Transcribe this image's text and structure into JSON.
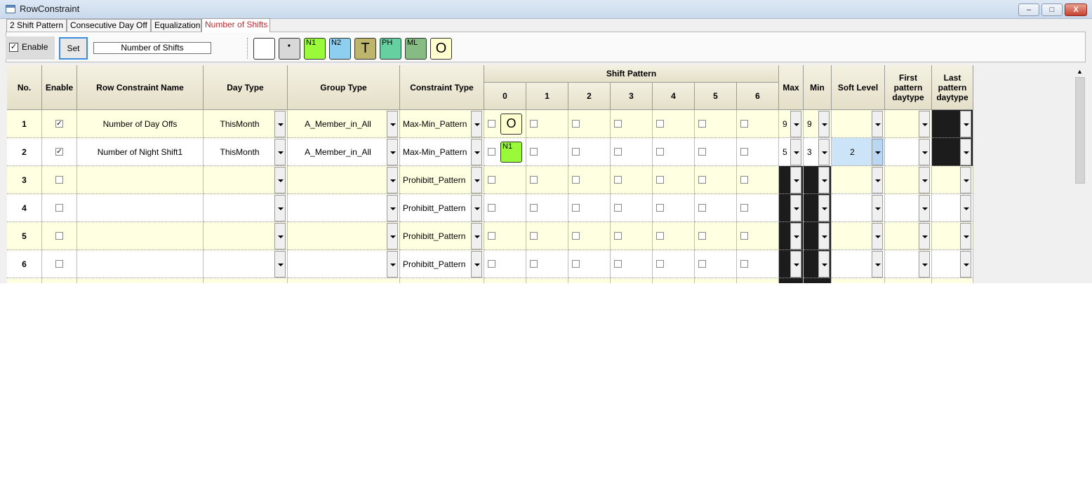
{
  "window": {
    "title": "RowConstraint",
    "minimize": "–",
    "restore": "□",
    "close": "X"
  },
  "tabs": [
    "2 Shift Pattern",
    "Consecutive Day Off",
    "Equalization",
    "Number of Shifts"
  ],
  "active_tab": 3,
  "toolbar": {
    "enable_label": "Enable",
    "enable_checked": true,
    "set_label": "Set",
    "name_value": "Number of Shifts"
  },
  "palette": [
    {
      "label": "",
      "color": "#ffffff"
    },
    {
      "label": "·",
      "color": "#d8d8d8"
    },
    {
      "label": "N1",
      "color": "#9afa3a"
    },
    {
      "label": "N2",
      "color": "#8ecff0"
    },
    {
      "label": "T",
      "color": "#bdb56c"
    },
    {
      "label": "PH",
      "color": "#66d0a0"
    },
    {
      "label": "ML",
      "color": "#86bc84"
    },
    {
      "label": "O",
      "color": "#ffffd0"
    }
  ],
  "columns": {
    "no": "No.",
    "enable": "Enable",
    "name": "Row Constraint Name",
    "day_type": "Day Type",
    "group_type": "Group Type",
    "constraint_type": "Constraint Type",
    "shift_pattern": "Shift Pattern",
    "shift_cols": [
      "0",
      "1",
      "2",
      "3",
      "4",
      "5",
      "6"
    ],
    "max": "Max",
    "min": "Min",
    "soft_level": "Soft Level",
    "first": "First pattern daytype",
    "last": "Last pattern daytype"
  },
  "rows": [
    {
      "no": "1",
      "enabled": true,
      "name": "Number of Day Offs",
      "day_type": "ThisMonth",
      "group_type": "A_Member_in_All",
      "constraint_type": "Max-Min_Pattern",
      "shift0": "O",
      "max": "9",
      "min": "9",
      "soft_level": ""
    },
    {
      "no": "2",
      "enabled": true,
      "name": "Number of Night Shift1",
      "day_type": "ThisMonth",
      "group_type": "A_Member_in_All",
      "constraint_type": "Max-Min_Pattern",
      "shift0": "N1",
      "max": "5",
      "min": "3",
      "soft_level": "2"
    },
    {
      "no": "3",
      "enabled": false,
      "name": "",
      "day_type": "",
      "group_type": "",
      "constraint_type": "Prohibitt_Pattern",
      "shift0": "",
      "max": "",
      "min": "",
      "soft_level": ""
    },
    {
      "no": "4",
      "enabled": false,
      "name": "",
      "day_type": "",
      "group_type": "",
      "constraint_type": "Prohibitt_Pattern",
      "shift0": "",
      "max": "",
      "min": "",
      "soft_level": ""
    },
    {
      "no": "5",
      "enabled": false,
      "name": "",
      "day_type": "",
      "group_type": "",
      "constraint_type": "Prohibitt_Pattern",
      "shift0": "",
      "max": "",
      "min": "",
      "soft_level": ""
    },
    {
      "no": "6",
      "enabled": false,
      "name": "",
      "day_type": "",
      "group_type": "",
      "constraint_type": "Prohibitt_Pattern",
      "shift0": "",
      "max": "",
      "min": "",
      "soft_level": ""
    }
  ]
}
